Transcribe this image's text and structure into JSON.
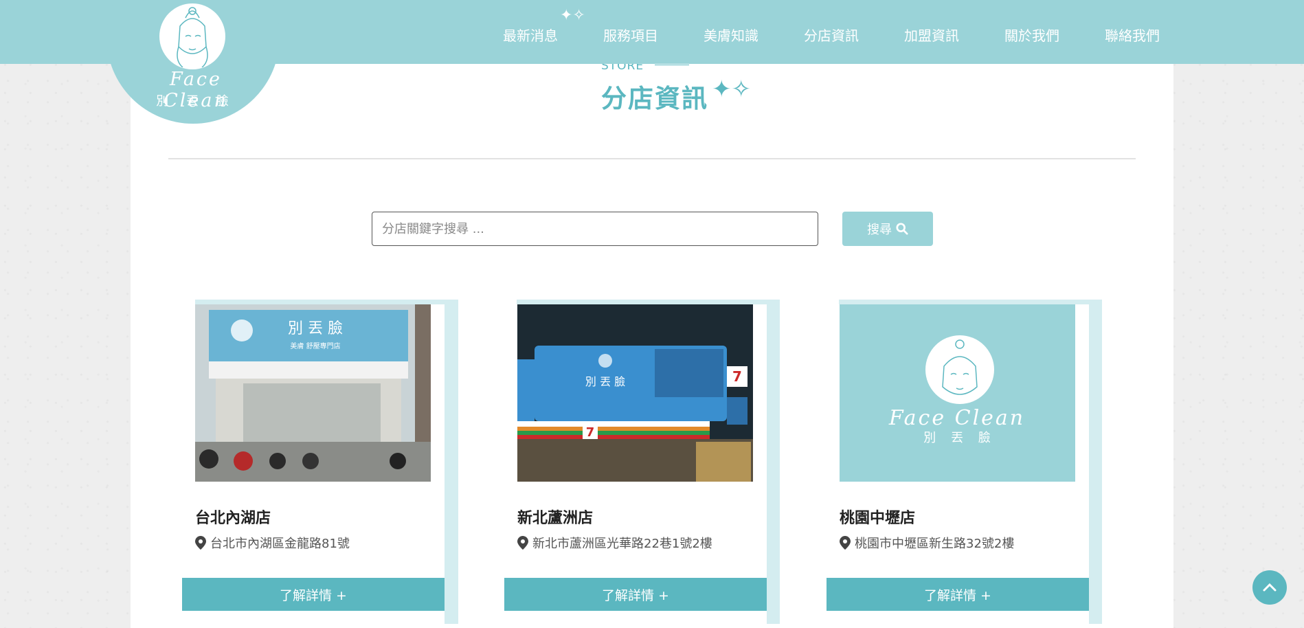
{
  "header": {
    "logo_script": "Face Clean",
    "logo_cn": "別 丟 臉",
    "nav": [
      "最新消息",
      "服務項目",
      "美膚知識",
      "分店資訊",
      "加盟資訊",
      "關於我們",
      "聯絡我們"
    ]
  },
  "section": {
    "en": "STORE",
    "title": "分店資訊"
  },
  "search": {
    "placeholder": "分店關鍵字搜尋 ...",
    "button_label": "搜尋"
  },
  "stores": [
    {
      "name": "台北內湖店",
      "address": "台北市內湖區金龍路81號",
      "button": "了解詳情 +"
    },
    {
      "name": "新北蘆洲店",
      "address": "新北市蘆洲區光華路22巷1號2樓",
      "button": "了解詳情 +"
    },
    {
      "name": "桃園中壢店",
      "address": "桃園市中壢區新生路32號2樓",
      "button": "了解詳情 +"
    }
  ],
  "store_photo_texts": {
    "sign_cn": "別 丟 臉",
    "sign_sub": "美膚 舒壓專門店",
    "placeholder_script": "Face Clean",
    "placeholder_cn": "別 丟 臉"
  },
  "colors": {
    "brand": "#9ad3d8",
    "accent": "#5bb7c0"
  }
}
